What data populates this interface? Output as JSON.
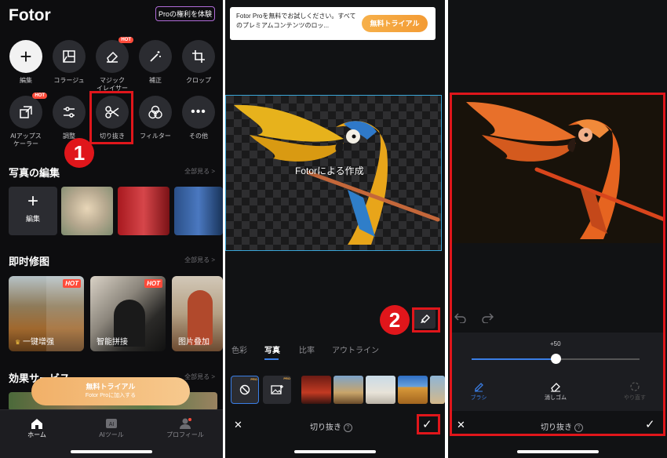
{
  "home": {
    "logo": "Fotor",
    "pro_button": "Proの権利を体験",
    "tools": [
      {
        "label": "編集",
        "icon": "plus-icon"
      },
      {
        "label": "コラージュ",
        "icon": "collage-icon"
      },
      {
        "label": "マジック\nイレイサー",
        "icon": "eraser-icon",
        "badge": "HOT"
      },
      {
        "label": "補正",
        "icon": "magic-wand-icon"
      },
      {
        "label": "クロップ",
        "icon": "crop-icon"
      },
      {
        "label": "AIアップス\nケーラー",
        "icon": "upscale-icon",
        "badge": "HOT"
      },
      {
        "label": "調整",
        "icon": "adjust-icon"
      },
      {
        "label": "切り抜き",
        "icon": "scissors-icon"
      },
      {
        "label": "フィルター",
        "icon": "filter-icon"
      },
      {
        "label": "その他",
        "icon": "more-icon"
      }
    ],
    "section_photo_edit": "写真の編集",
    "see_all": "全部見る >",
    "edit_card_label": "編集",
    "section_instant": "即时修图",
    "features": [
      {
        "label": "一键增强",
        "badge": "HOT"
      },
      {
        "label": "智能拼接",
        "badge": "HOT"
      },
      {
        "label": "图片叠加"
      }
    ],
    "section_effects": "効果サービス",
    "trial_line1": "無料トライアル",
    "trial_line2": "Fotor Proに加入する",
    "tabs": [
      "ホーム",
      "AIツール",
      "プロフィール"
    ]
  },
  "cutout": {
    "banner_text": "Fotor Proを無料でお試しください。すべてのプレミアムコンテンツのロッ...",
    "banner_button": "無料トライアル",
    "watermark": "Fotorによる作成",
    "tabs": [
      "色彩",
      "写真",
      "比率",
      "アウトライン"
    ],
    "active_tab": "写真",
    "pro_badge": "PRO",
    "title": "切り抜き"
  },
  "brush": {
    "slider_value": "+50",
    "slider_fraction": 0.5,
    "tools": [
      "ブラシ",
      "消しゴム",
      "やり直す"
    ],
    "title": "切り抜き"
  },
  "markers": [
    "1",
    "2"
  ],
  "colors": {
    "highlight": "#e0161b",
    "accent": "#3a7ee6",
    "trial": "#f39b34"
  }
}
